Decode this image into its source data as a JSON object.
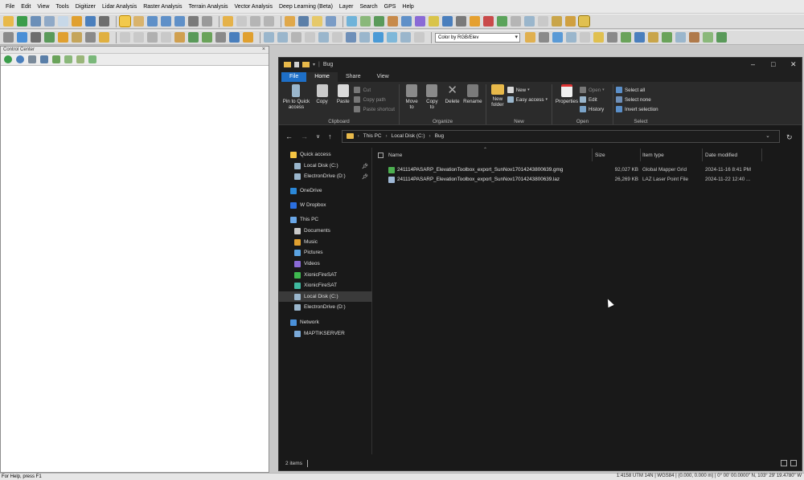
{
  "menubar": [
    "File",
    "Edit",
    "View",
    "Tools",
    "Digitizer",
    "Lidar Analysis",
    "Raster Analysis",
    "Terrain Analysis",
    "Vector Analysis",
    "Deep Learning (Beta)",
    "Layer",
    "Search",
    "GPS",
    "Help"
  ],
  "toolbar2": {
    "shader_combo_value": "Color by RGB/Elev"
  },
  "control_center": {
    "title": "Control Center",
    "close_glyph": "×"
  },
  "statusbar": {
    "left": "For Help, press F1",
    "right": "1:4158  UTM 14N | WGS84 | (0.000, 0.000 m) | 0° 00' 00.0000\" N, 103° 29' 19.4780\" W"
  },
  "explorer": {
    "window_title": "Bug",
    "tabs": [
      "File",
      "Home",
      "Share",
      "View"
    ],
    "ribbon": {
      "clipboard": {
        "label": "Clipboard",
        "pin": "Pin to Quick\naccess",
        "copy": "Copy",
        "paste": "Paste",
        "cut": "Cut",
        "copy_path": "Copy path",
        "paste_shortcut": "Paste shortcut"
      },
      "organize": {
        "label": "Organize",
        "move_to": "Move\nto",
        "copy_to": "Copy\nto",
        "delete": "Delete",
        "rename": "Rename"
      },
      "new": {
        "label": "New",
        "new_folder": "New\nfolder",
        "new_item": "New",
        "easy_access": "Easy access"
      },
      "open": {
        "label": "Open",
        "properties": "Properties",
        "open": "Open",
        "edit": "Edit",
        "history": "History"
      },
      "select": {
        "label": "Select",
        "select_all": "Select all",
        "select_none": "Select none",
        "invert": "Invert selection"
      }
    },
    "address": {
      "segments": [
        "This PC",
        "Local Disk (C:)",
        "Bug"
      ]
    },
    "nav": [
      {
        "label": "Quick access",
        "color": "#f5c542"
      },
      {
        "label": "Local Disk (C:)",
        "color": "#9ab6cc"
      },
      {
        "label": "ElectronDrive (D:)",
        "color": "#9ab6cc"
      },
      {
        "label": "OneDrive",
        "color": "#2b88d8"
      },
      {
        "label": "W Dropbox",
        "color": "#2b6fe0"
      },
      {
        "label": "This PC",
        "color": "#6aa7e8"
      },
      {
        "label": "Documents",
        "color": "#c9c9c9"
      },
      {
        "label": "Music",
        "color": "#e0a030"
      },
      {
        "label": "Pictures",
        "color": "#5ba3e0"
      },
      {
        "label": "Videos",
        "color": "#8a6ad6"
      },
      {
        "label": "XionicFireSAT",
        "color": "#3fb950"
      },
      {
        "label": "XionicFireSAT",
        "color": "#3fb9a0"
      },
      {
        "label": "Local Disk (C:)",
        "color": "#9ab6cc"
      },
      {
        "label": "ElectronDrive (D:)",
        "color": "#9ab6cc"
      },
      {
        "label": "Network",
        "color": "#4a90d9"
      },
      {
        "label": "MAPTIKSERVER",
        "color": "#7aa9d8"
      }
    ],
    "columns": {
      "name": "Name",
      "size": "Size",
      "type": "Item type",
      "date": "Date modified"
    },
    "files": [
      {
        "name": "241114PASARP_ElevationToolbox_export_SunNov17014243800639.gmg",
        "size": "92,027 KB",
        "type": "Global Mapper Grid",
        "date": "2024-11-16 8:41 PM",
        "icon_color": "#4caf50"
      },
      {
        "name": "241114PASARP_ElevationToolbox_export_SunNov17014243800639.laz",
        "size": "26,269 KB",
        "type": "LAZ Laser Point File",
        "date": "2024-11-22 12:40 ...",
        "icon_color": "#9fb8d6"
      }
    ],
    "status": {
      "count": "2 items"
    }
  }
}
